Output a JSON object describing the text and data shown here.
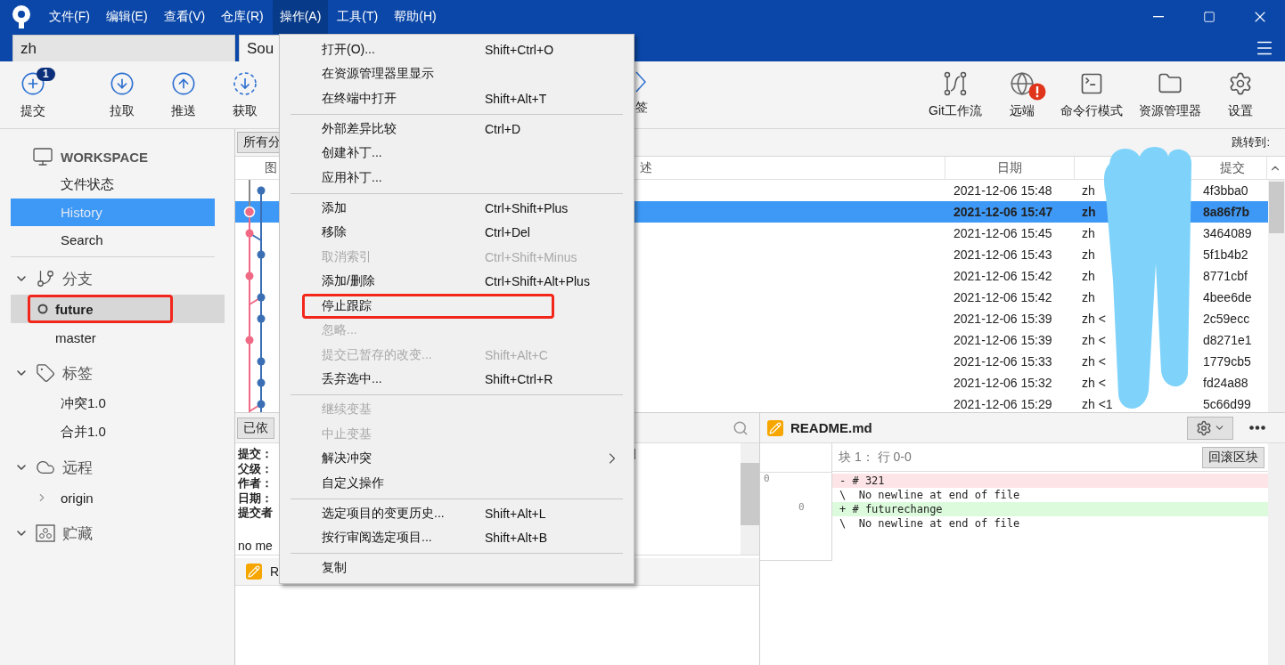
{
  "menubar": [
    {
      "label": "文件(F)",
      "selected": false
    },
    {
      "label": "编辑(E)",
      "selected": false
    },
    {
      "label": "查看(V)",
      "selected": false
    },
    {
      "label": "仓库(R)",
      "selected": false
    },
    {
      "label": "操作(A)",
      "selected": true
    },
    {
      "label": "工具(T)",
      "selected": false
    },
    {
      "label": "帮助(H)",
      "selected": false
    }
  ],
  "repo_tabs": [
    {
      "label": "zh",
      "selected": false
    },
    {
      "label": "Sou",
      "selected": true
    }
  ],
  "toolbar_left": [
    {
      "label": "提交",
      "badge": "1"
    },
    {
      "label": "拉取"
    },
    {
      "label": "推送"
    },
    {
      "label": "获取"
    },
    {
      "label": "签"
    }
  ],
  "toolbar_right": [
    {
      "label": "Git工作流",
      "alert": false
    },
    {
      "label": "远端",
      "alert": true
    },
    {
      "label": "命令行模式",
      "alert": false
    },
    {
      "label": "资源管理器",
      "alert": false
    },
    {
      "label": "设置",
      "alert": false
    }
  ],
  "sidebar": {
    "workspace": {
      "title": "WORKSPACE",
      "items": [
        {
          "label": "文件状态",
          "selected": false
        },
        {
          "label": "History",
          "selected": true
        },
        {
          "label": "Search",
          "selected": false
        }
      ]
    },
    "sections": [
      {
        "title": "分支",
        "expanded": true,
        "items": [
          {
            "label": "future",
            "current": true,
            "annotated": true
          },
          {
            "label": "master",
            "current": false,
            "annotated": false
          }
        ]
      },
      {
        "title": "标签",
        "expanded": true,
        "items": [
          {
            "label": "冲突1.0"
          },
          {
            "label": "合并1.0"
          }
        ]
      },
      {
        "title": "远程",
        "expanded": true,
        "items": [
          {
            "label": "origin",
            "expanded": false
          }
        ]
      },
      {
        "title": "贮藏",
        "expanded": true
      }
    ]
  },
  "history": {
    "filter_button": "所有分",
    "jump_label": "跳转到:",
    "columns": {
      "graph": "图",
      "description": "述",
      "date": "日期",
      "commit": "提交"
    },
    "rows": [
      {
        "date": "2021-12-06 15:48",
        "author": "zh",
        "commit": "4f3bba0",
        "selected": false
      },
      {
        "date": "2021-12-06 15:47",
        "author": "zh",
        "commit": "8a86f7b",
        "selected": true
      },
      {
        "date": "2021-12-06 15:45",
        "author": "zh",
        "commit": "3464089",
        "selected": false
      },
      {
        "date": "2021-12-06 15:43",
        "author": "zh",
        "commit": "5f1b4b2",
        "selected": false
      },
      {
        "date": "2021-12-06 15:42",
        "author": "zh",
        "commit": "8771cbf",
        "selected": false
      },
      {
        "date": "2021-12-06 15:42",
        "author": "zh",
        "commit": "4bee6de",
        "selected": false
      },
      {
        "date": "2021-12-06 15:39",
        "author": "zh <",
        "commit": "2c59ecc",
        "selected": false
      },
      {
        "date": "2021-12-06 15:39",
        "author": "zh <",
        "commit": "d8271e1",
        "selected": false
      },
      {
        "date": "2021-12-06 15:33",
        "author": "zh <",
        "commit": "1779cb5",
        "selected": false
      },
      {
        "date": "2021-12-06 15:32",
        "author": "zh <",
        "commit": "fd24a88",
        "selected": false
      },
      {
        "date": "2021-12-06 15:29",
        "author": "zh <1",
        "commit": "5c66d99",
        "selected": false
      }
    ]
  },
  "commit_detail": {
    "view_button": "已依",
    "labels": [
      "提交：",
      "父级：",
      "作者：",
      "日期：",
      "提交者"
    ],
    "bracket": "]",
    "message": "no me",
    "file": "R"
  },
  "diff": {
    "file": "README.md",
    "hunk_title": "块 1： 行 0-0",
    "hunk_button": "回滚区块",
    "lines": [
      {
        "kind": "removed",
        "old": "0",
        "text": "- # 321"
      },
      {
        "kind": "context",
        "text": "\\  No newline at end of file"
      },
      {
        "kind": "added",
        "new": "0",
        "text": "+ # futurechange"
      },
      {
        "kind": "context",
        "text": "\\  No newline at end of file"
      }
    ]
  },
  "action_menu": {
    "items": [
      {
        "kind": "item",
        "label": "打开(O)...",
        "shortcut": "Shift+Ctrl+O",
        "disabled": false,
        "annotated": false
      },
      {
        "kind": "item",
        "label": "在资源管理器里显示",
        "disabled": false,
        "annotated": false
      },
      {
        "kind": "item",
        "label": "在终端中打开",
        "shortcut": "Shift+Alt+T",
        "disabled": false,
        "annotated": false
      },
      {
        "kind": "separator"
      },
      {
        "kind": "item",
        "label": "外部差异比较",
        "shortcut": "Ctrl+D",
        "disabled": false,
        "annotated": false
      },
      {
        "kind": "item",
        "label": "创建补丁...",
        "disabled": false,
        "annotated": false
      },
      {
        "kind": "item",
        "label": "应用补丁...",
        "disabled": false,
        "annotated": false
      },
      {
        "kind": "separator"
      },
      {
        "kind": "item",
        "label": "添加",
        "shortcut": "Ctrl+Shift+Plus",
        "disabled": false,
        "annotated": false
      },
      {
        "kind": "item",
        "label": "移除",
        "shortcut": "Ctrl+Del",
        "disabled": false,
        "annotated": false
      },
      {
        "kind": "item",
        "label": "取消索引",
        "shortcut": "Ctrl+Shift+Minus",
        "disabled": true,
        "annotated": false
      },
      {
        "kind": "item",
        "label": "添加/删除",
        "shortcut": "Ctrl+Shift+Alt+Plus",
        "disabled": false,
        "annotated": false
      },
      {
        "kind": "item",
        "label": "停止跟踪",
        "disabled": false,
        "annotated": true
      },
      {
        "kind": "item",
        "label": "忽略...",
        "disabled": true,
        "annotated": false
      },
      {
        "kind": "item",
        "label": "提交已暂存的改变...",
        "shortcut": "Shift+Alt+C",
        "disabled": true,
        "annotated": false
      },
      {
        "kind": "item",
        "label": "丢弃选中...",
        "shortcut": "Shift+Ctrl+R",
        "disabled": false,
        "annotated": false
      },
      {
        "kind": "separator"
      },
      {
        "kind": "item",
        "label": "继续变基",
        "disabled": true,
        "annotated": false
      },
      {
        "kind": "item",
        "label": "中止变基",
        "disabled": true,
        "annotated": false
      },
      {
        "kind": "submenu",
        "label": "解决冲突",
        "disabled": false,
        "annotated": false
      },
      {
        "kind": "item",
        "label": "自定义操作",
        "disabled": false,
        "annotated": false
      },
      {
        "kind": "separator"
      },
      {
        "kind": "item",
        "label": "选定项目的变更历史...",
        "shortcut": "Shift+Alt+L",
        "disabled": false,
        "annotated": false
      },
      {
        "kind": "item",
        "label": "按行审阅选定项目...",
        "shortcut": "Shift+Alt+B",
        "disabled": false,
        "annotated": false
      },
      {
        "kind": "separator"
      },
      {
        "kind": "item",
        "label": "复制",
        "disabled": false,
        "annotated": false
      }
    ]
  }
}
